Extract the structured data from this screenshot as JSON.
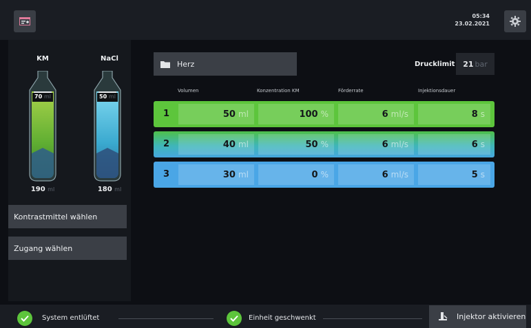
{
  "header": {
    "time": "05:34",
    "date": "23.02.2021"
  },
  "left": {
    "bottles": [
      {
        "name": "KM",
        "fill_label": "70",
        "fill_unit": "ml",
        "amount": "190",
        "unit": "ml",
        "color": "#7dbd3a"
      },
      {
        "name": "NaCl",
        "fill_label": "50",
        "fill_unit": "ml",
        "amount": "180",
        "unit": "ml",
        "color": "#3aa9cf"
      }
    ],
    "buttons": {
      "contrast": "Kontrastmittel wählen",
      "access": "Zugang wählen"
    }
  },
  "main": {
    "protocol": "Herz",
    "pressure_label": "Drucklimit",
    "pressure_value": "21",
    "pressure_unit": "bar",
    "columns": [
      "Volumen",
      "Konzentration KM",
      "Förderrate",
      "Injektionsdauer"
    ],
    "rows": [
      {
        "num": "1",
        "volume": "50",
        "volume_unit": "ml",
        "conc": "100",
        "conc_unit": "%",
        "rate": "6",
        "rate_unit": "ml/s",
        "dur": "8",
        "dur_unit": "s"
      },
      {
        "num": "2",
        "volume": "40",
        "volume_unit": "ml",
        "conc": "50",
        "conc_unit": "%",
        "rate": "6",
        "rate_unit": "ml/s",
        "dur": "6",
        "dur_unit": "s"
      },
      {
        "num": "3",
        "volume": "30",
        "volume_unit": "ml",
        "conc": "0",
        "conc_unit": "%",
        "rate": "6",
        "rate_unit": "ml/s",
        "dur": "5",
        "dur_unit": "s"
      }
    ]
  },
  "footer": {
    "status1": "System entlüftet",
    "status2": "Einheit geschwenkt",
    "activate": "Injektor aktivieren"
  },
  "colors": {
    "green": "#5dc53c",
    "blue": "#4aa6e6",
    "button": "#3b3f46"
  }
}
